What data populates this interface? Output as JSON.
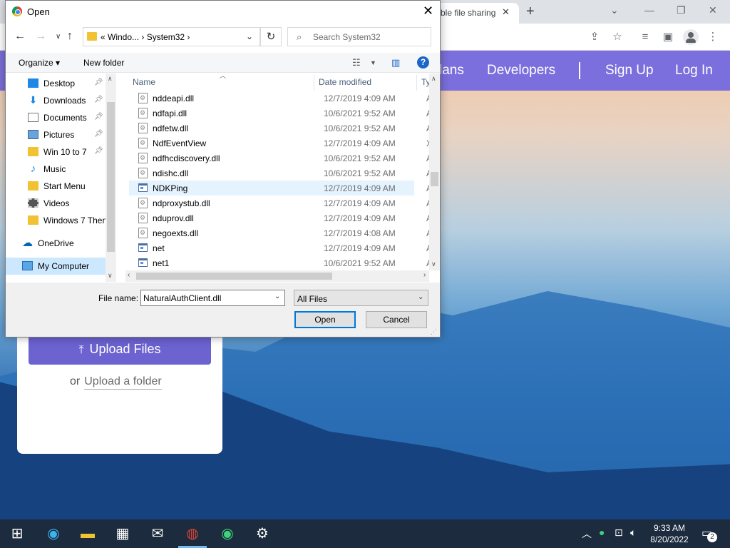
{
  "browser": {
    "tab_title": "ble file sharing",
    "tab_close": "✕",
    "new_tab": "+"
  },
  "site": {
    "nav": [
      "lans",
      "Developers",
      "Sign Up",
      "Log In"
    ],
    "upload_button": "Upload Files",
    "or_text": "or",
    "upload_folder": "Upload a folder"
  },
  "dialog": {
    "title": "Open",
    "breadcrumb": "«  Windo...  ›  System32  ›",
    "search_placeholder": "Search System32",
    "organize": "Organize ▾",
    "new_folder": "New folder",
    "nav_items": [
      {
        "label": "Desktop",
        "icon": "desktop-icon",
        "pinned": true
      },
      {
        "label": "Downloads",
        "icon": "downloads-icon",
        "pinned": true
      },
      {
        "label": "Documents",
        "icon": "documents-icon",
        "pinned": true
      },
      {
        "label": "Pictures",
        "icon": "pictures-icon",
        "pinned": true
      },
      {
        "label": "Win 10 to 7",
        "icon": "folder-icon",
        "pinned": true
      },
      {
        "label": "Music",
        "icon": "music-icon",
        "pinned": false
      },
      {
        "label": "Start Menu",
        "icon": "folder-icon",
        "pinned": false
      },
      {
        "label": "Videos",
        "icon": "videos-icon",
        "pinned": false
      },
      {
        "label": "Windows 7 Then",
        "icon": "folder-icon",
        "pinned": false
      },
      {
        "label": "OneDrive",
        "icon": "onedrive-icon",
        "pinned": false
      },
      {
        "label": "My Computer",
        "icon": "computer-icon",
        "pinned": false
      }
    ],
    "columns": {
      "name": "Name",
      "date": "Date modified",
      "type": "Ty"
    },
    "files": [
      {
        "name": "nddeapi.dll",
        "date": "12/7/2019 4:09 AM",
        "type": "A",
        "kind": "dll"
      },
      {
        "name": "ndfapi.dll",
        "date": "10/6/2021 9:52 AM",
        "type": "A",
        "kind": "dll"
      },
      {
        "name": "ndfetw.dll",
        "date": "10/6/2021 9:52 AM",
        "type": "A",
        "kind": "dll"
      },
      {
        "name": "NdfEventView",
        "date": "12/7/2019 4:09 AM",
        "type": "X",
        "kind": "dll"
      },
      {
        "name": "ndfhcdiscovery.dll",
        "date": "10/6/2021 9:52 AM",
        "type": "A",
        "kind": "dll"
      },
      {
        "name": "ndishc.dll",
        "date": "10/6/2021 9:52 AM",
        "type": "A",
        "kind": "dll"
      },
      {
        "name": "NDKPing",
        "date": "12/7/2019 4:09 AM",
        "type": "A",
        "kind": "exe"
      },
      {
        "name": "ndproxystub.dll",
        "date": "12/7/2019 4:09 AM",
        "type": "A",
        "kind": "dll"
      },
      {
        "name": "nduprov.dll",
        "date": "12/7/2019 4:09 AM",
        "type": "A",
        "kind": "dll"
      },
      {
        "name": "negoexts.dll",
        "date": "12/7/2019 4:08 AM",
        "type": "A",
        "kind": "dll"
      },
      {
        "name": "net",
        "date": "12/7/2019 4:09 AM",
        "type": "A",
        "kind": "exe"
      },
      {
        "name": "net1",
        "date": "10/6/2021 9:52 AM",
        "type": "A",
        "kind": "exe"
      }
    ],
    "file_name_label": "File name:",
    "file_name_value": "NaturalAuthClient.dll",
    "file_type": "All Files",
    "open_button": "Open",
    "cancel_button": "Cancel"
  },
  "taskbar": {
    "time": "9:33 AM",
    "date": "8/20/2022",
    "notification_count": "2"
  },
  "colors": {
    "site_nav": "#7a6fdc",
    "upload_button": "#6c62d0",
    "taskbar": "#1c2b3d",
    "selection": "#cce8ff"
  }
}
